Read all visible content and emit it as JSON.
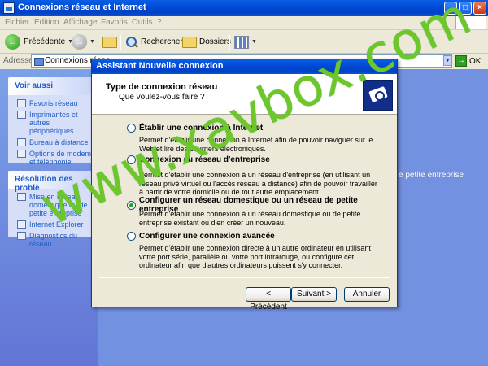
{
  "window": {
    "title": "Connexions réseau et Internet",
    "buttons": {
      "minimize": "_",
      "maximize": "□",
      "close": "×"
    }
  },
  "menubar": {
    "items": [
      "Fichier",
      "Edition",
      "Affichage",
      "Favoris",
      "Outils",
      "?"
    ]
  },
  "toolbar": {
    "back": "Précédente",
    "search": "Rechercher",
    "folders": "Dossiers"
  },
  "addressbar": {
    "label": "Adresse",
    "value": "Connexions résea",
    "ok": "OK"
  },
  "leftpane": {
    "see_also": {
      "title": "Voir aussi",
      "items": [
        "Favoris réseau",
        "Imprimantes et autres périphériques",
        "Bureau à distance",
        "Options de modems et téléphonie"
      ]
    },
    "troubleshoot": {
      "title": "Résolution des problè",
      "items": [
        "Mise en réseau domestique ou de petite entreprise",
        "Internet Explorer",
        "Diagnostics du réseau"
      ]
    }
  },
  "background_text": "e petite entreprise",
  "dialog": {
    "title": "Assistant Nouvelle connexion",
    "header_title": "Type de connexion réseau",
    "header_subtitle": "Que voulez-vous faire ?",
    "options": [
      {
        "label": "Établir une connexion à Internet",
        "desc": "Permet d'établir une connexion à Internet afin de pouvoir naviguer sur le Web et lire des courriers électroniques.",
        "checked": false
      },
      {
        "label": "Connexion au réseau d'entreprise",
        "desc": "Permet d'établir une connexion à un réseau d'entreprise (en utilisant un réseau privé virtuel ou l'accès réseau à distance) afin de pouvoir travailler à partir de votre domicile ou de tout autre emplacement.",
        "checked": false
      },
      {
        "label": "Configurer un réseau domestique ou un réseau de petite entreprise",
        "desc": "Permet d'établir une connexion à un réseau domestique ou de petite entreprise existant ou d'en créer un nouveau.",
        "checked": true
      },
      {
        "label": "Configurer une connexion avancée",
        "desc": "Permet d'établir une connexion directe à un autre ordinateur en utilisant votre port série, parallèle ou votre port infrarouge, ou configure cet ordinateur afin que d'autres ordinateurs puissent s'y connecter.",
        "checked": false
      }
    ],
    "buttons": {
      "back": "< Précédent",
      "next": "Suivant >",
      "cancel": "Annuler"
    }
  },
  "watermark": "www.xavbox.com"
}
